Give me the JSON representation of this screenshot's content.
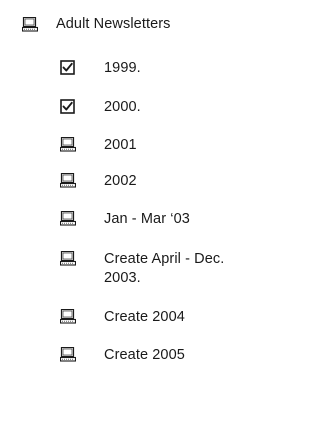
{
  "header": {
    "label": "Adult Newsletters",
    "icon": "computer-icon"
  },
  "items": [
    {
      "label": "1999.",
      "icon": "checkbox-checked-icon",
      "checked": true
    },
    {
      "label": "2000.",
      "icon": "checkbox-checked-icon",
      "checked": true
    },
    {
      "label": "2001",
      "icon": "computer-icon"
    },
    {
      "label": "2002",
      "icon": "computer-icon"
    },
    {
      "label": "Jan - Mar ‘03",
      "icon": "computer-icon"
    },
    {
      "label_line1": "Create April - Dec.",
      "label_line2": "2003.",
      "icon": "computer-icon"
    },
    {
      "label": "Create 2004",
      "icon": "computer-icon"
    },
    {
      "label": "Create 2005",
      "icon": "computer-icon"
    }
  ]
}
